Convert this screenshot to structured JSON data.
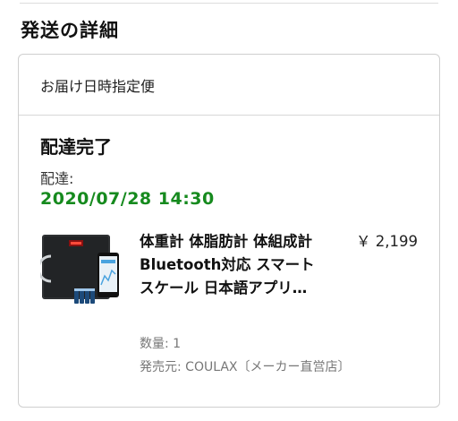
{
  "section": {
    "title": "発送の詳細"
  },
  "shipment": {
    "header": "お届け日時指定便",
    "status": "配達完了",
    "delivery_label": "配達:",
    "delivery_date": "2020/07/28 14:30"
  },
  "product": {
    "name": "体重計 体脂肪計 体組成計 Bluetooth対応 スマートスケール 日本語アプリ…",
    "price": "￥ 2,199",
    "quantity": "数量: 1",
    "seller": "発売元: COULAX〔メーカー直営店〕",
    "thumbnail_icon": "smart-scale-product-image"
  },
  "colors": {
    "delivery_date": "#168a1e",
    "muted_text": "#777777",
    "border": "#cfcfcf"
  }
}
